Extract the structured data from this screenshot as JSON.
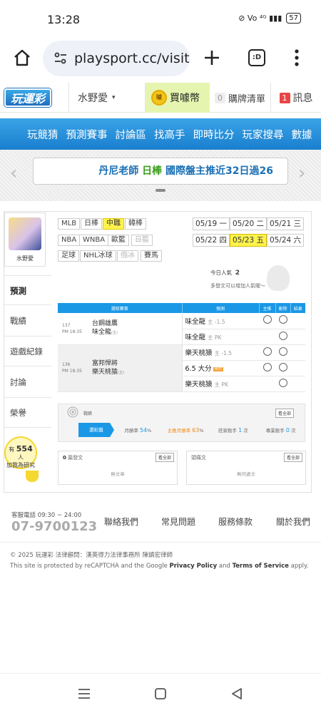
{
  "status": {
    "time": "13:28",
    "icons": "⊘ Vo ⁴ᴳ ▮▮▮",
    "battery": "57"
  },
  "browser": {
    "url": "playsport.cc/visit",
    "tab_count": ":D"
  },
  "site": {
    "logo": "玩運彩",
    "user": "水野愛",
    "coin_label": "買噱幣",
    "coin_icon_text": "噱",
    "cart_count": "0",
    "cart_label": "購牌清單",
    "msg_count": "1",
    "msg_label": "訊息"
  },
  "nav": [
    "玩競猜",
    "預測賽事",
    "討論區",
    "找高手",
    "即時比分",
    "玩家搜尋",
    "數據"
  ],
  "banner": {
    "pre": "丹尼老師 ",
    "green": "日棒",
    "post": " 國際盤主推近32日過26"
  },
  "profile": {
    "name": "水野愛"
  },
  "side_menu": [
    "預測",
    "戰績",
    "遊戲紀錄",
    "討論",
    "榮譽"
  ],
  "side_badge": {
    "line1": "有",
    "count": "554",
    "line1b": "人",
    "line2": "加我為研究"
  },
  "league_tags": [
    "MLB",
    "日棒",
    "中職",
    "韓棒",
    "NBA",
    "WNBA",
    "歐籃",
    "日籃",
    "足球",
    "NHL冰球",
    "俄冰",
    "賽馬"
  ],
  "dates": [
    {
      "d": "05/19",
      "w": "一"
    },
    {
      "d": "05/20",
      "w": "二"
    },
    {
      "d": "05/21",
      "w": "三"
    },
    {
      "d": "05/22",
      "w": "四"
    },
    {
      "d": "05/23",
      "w": "五"
    },
    {
      "d": "05/24",
      "w": "六"
    }
  ],
  "popularity": {
    "label": "今日人氣",
    "value": "2",
    "hint": "多發文可以增加人氣喔～"
  },
  "table": {
    "headers": [
      "選取賽事",
      "預測",
      "主推",
      "刪除",
      "結果"
    ],
    "games": [
      {
        "no": "137",
        "time": "PM 18:35",
        "team1": "台鋼雄鷹",
        "team2": "味全龍",
        "team2_mark": "(主)"
      },
      {
        "no": "136",
        "time": "PM 18:35",
        "team1": "富邦悍將",
        "team2": "樂天桃猿",
        "team2_mark": "(主)"
      }
    ],
    "picks": [
      {
        "team": "味全龍",
        "note": "主 -1.5"
      },
      {
        "team": "味全龍",
        "note": "主 PK"
      },
      {
        "team": "樂天桃猿",
        "note": "主 -1.5"
      },
      {
        "team": "6.5 大分",
        "note": "大分"
      },
      {
        "team": "樂天桃猿",
        "note": "主 PK"
      }
    ]
  },
  "stats": {
    "title": "戰績",
    "see_all": "看全部",
    "tab": "選彩盤",
    "month_rate_label": "月勝率",
    "month_rate": "54",
    "main_rate_label": "主推月勝率",
    "main_rate": "63",
    "league_rank_label": "莊家殺手",
    "league_rank": "1",
    "big_label": "專業殺手",
    "big": "0",
    "pct": "%",
    "unit": "次"
  },
  "posts": {
    "left_count": "0",
    "left_label": "篇發文",
    "left_empty": "無文章",
    "right_label": "頭痛文",
    "right_empty": "無何處文",
    "see_all": "看全部"
  },
  "footer": {
    "service_label": "客服電話 09:30 ~ 24:00",
    "phone": "07-9700123",
    "links": [
      "聯絡我們",
      "常見問題",
      "服務條款",
      "關於我們"
    ],
    "copyright": "© 2025 玩運彩 法律顧問：漢英得力法律事務所 陳鎮宏律師",
    "protect_pre": "This site is protected by reCAPTCHA and the Google ",
    "privacy": "Privacy Policy",
    "and": " and ",
    "terms": "Terms of Service",
    "apply": " apply."
  }
}
